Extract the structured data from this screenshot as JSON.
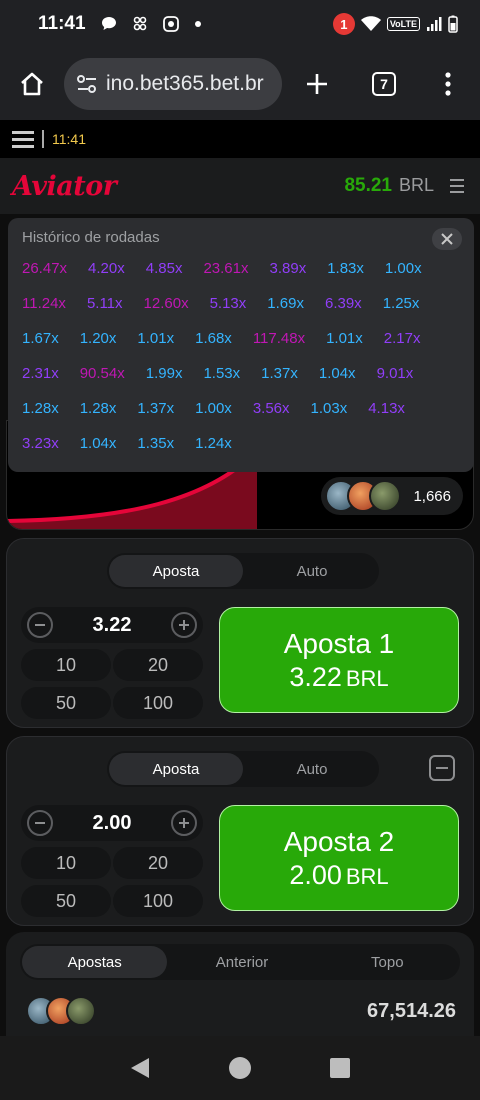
{
  "statusbar": {
    "time": "11:41",
    "notification_count": "1",
    "network": "VoLTE"
  },
  "browser": {
    "url": "ino.bet365.bet.br",
    "tab_count": "7"
  },
  "game_topbar": {
    "clock": "11:41"
  },
  "header": {
    "logo": "Aviator",
    "balance": "85.21",
    "currency": "BRL"
  },
  "history": {
    "title": "Histórico de rodadas",
    "multipliers": [
      {
        "v": "26.47x",
        "c": "pink"
      },
      {
        "v": "4.20x",
        "c": "purple"
      },
      {
        "v": "4.85x",
        "c": "purple"
      },
      {
        "v": "23.61x",
        "c": "pink"
      },
      {
        "v": "3.89x",
        "c": "purple"
      },
      {
        "v": "1.83x",
        "c": "blue"
      },
      {
        "v": "1.00x",
        "c": "blue"
      },
      {
        "v": "11.24x",
        "c": "pink"
      },
      {
        "v": "5.11x",
        "c": "purple"
      },
      {
        "v": "12.60x",
        "c": "pink"
      },
      {
        "v": "5.13x",
        "c": "purple"
      },
      {
        "v": "1.69x",
        "c": "blue"
      },
      {
        "v": "6.39x",
        "c": "purple"
      },
      {
        "v": "1.25x",
        "c": "blue"
      },
      {
        "v": "1.67x",
        "c": "blue"
      },
      {
        "v": "1.20x",
        "c": "blue"
      },
      {
        "v": "1.01x",
        "c": "blue"
      },
      {
        "v": "1.68x",
        "c": "blue"
      },
      {
        "v": "117.48x",
        "c": "pink"
      },
      {
        "v": "1.01x",
        "c": "blue"
      },
      {
        "v": "2.17x",
        "c": "purple"
      },
      {
        "v": "2.31x",
        "c": "purple"
      },
      {
        "v": "90.54x",
        "c": "pink"
      },
      {
        "v": "1.99x",
        "c": "blue"
      },
      {
        "v": "1.53x",
        "c": "blue"
      },
      {
        "v": "1.37x",
        "c": "blue"
      },
      {
        "v": "1.04x",
        "c": "blue"
      },
      {
        "v": "9.01x",
        "c": "purple"
      },
      {
        "v": "1.28x",
        "c": "blue"
      },
      {
        "v": "1.28x",
        "c": "blue"
      },
      {
        "v": "1.37x",
        "c": "blue"
      },
      {
        "v": "1.00x",
        "c": "blue"
      },
      {
        "v": "3.56x",
        "c": "purple"
      },
      {
        "v": "1.03x",
        "c": "blue"
      },
      {
        "v": "4.13x",
        "c": "purple"
      },
      {
        "v": "3.23x",
        "c": "purple"
      },
      {
        "v": "1.04x",
        "c": "blue"
      },
      {
        "v": "1.35x",
        "c": "blue"
      },
      {
        "v": "1.24x",
        "c": "blue"
      }
    ]
  },
  "flight": {
    "players_count": "1,666"
  },
  "bet_panels": [
    {
      "tabs": [
        "Aposta",
        "Auto"
      ],
      "stake": "3.22",
      "quick": [
        "10",
        "20",
        "50",
        "100"
      ],
      "button_label": "Aposta 1",
      "button_amount": "3.22",
      "button_currency": "BRL"
    },
    {
      "tabs": [
        "Aposta",
        "Auto"
      ],
      "stake": "2.00",
      "quick": [
        "10",
        "20",
        "50",
        "100"
      ],
      "button_label": "Aposta 2",
      "button_amount": "2.00",
      "button_currency": "BRL"
    }
  ],
  "bets_list": {
    "tabs": [
      "Apostas",
      "Anterior",
      "Topo"
    ],
    "total": "67,514.26"
  },
  "colors": {
    "accent_green": "#28a909",
    "logo_red": "#e50539",
    "mult_blue": "#34b4ff",
    "mult_purple": "#913ef8",
    "mult_pink": "#c017b4"
  }
}
